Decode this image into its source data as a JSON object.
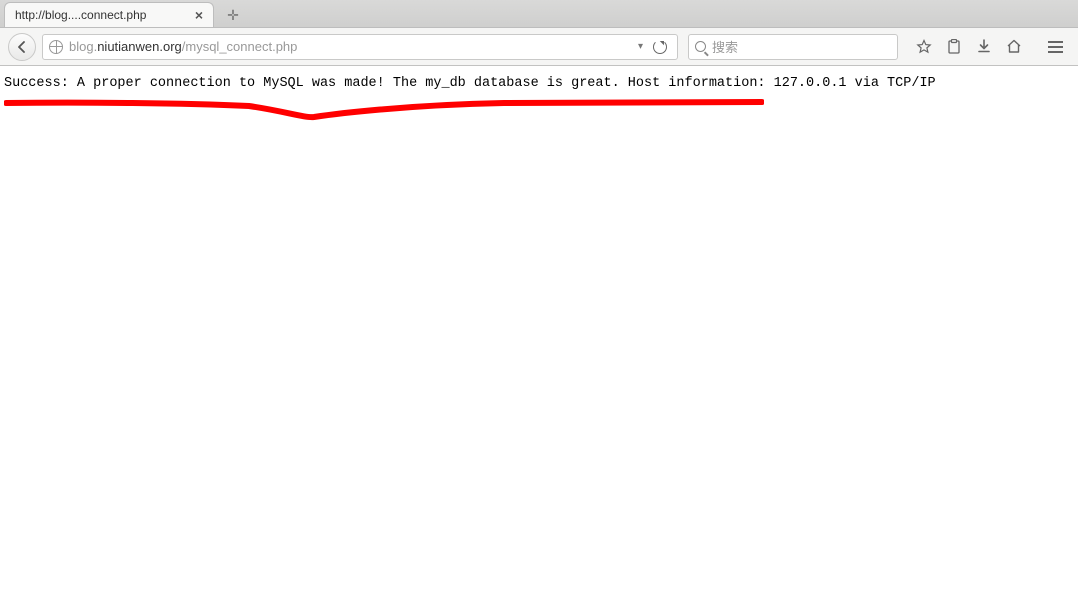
{
  "tab": {
    "title": "http://blog....connect.php"
  },
  "urlbar": {
    "prefix": "blog.",
    "domain": "niutianwen.org",
    "path": "/mysql_connect.php",
    "dropdown": "▾"
  },
  "search": {
    "placeholder": "搜索"
  },
  "page": {
    "message": "Success: A proper connection to MySQL was made! The my_db database is great. Host information: 127.0.0.1 via TCP/IP"
  }
}
